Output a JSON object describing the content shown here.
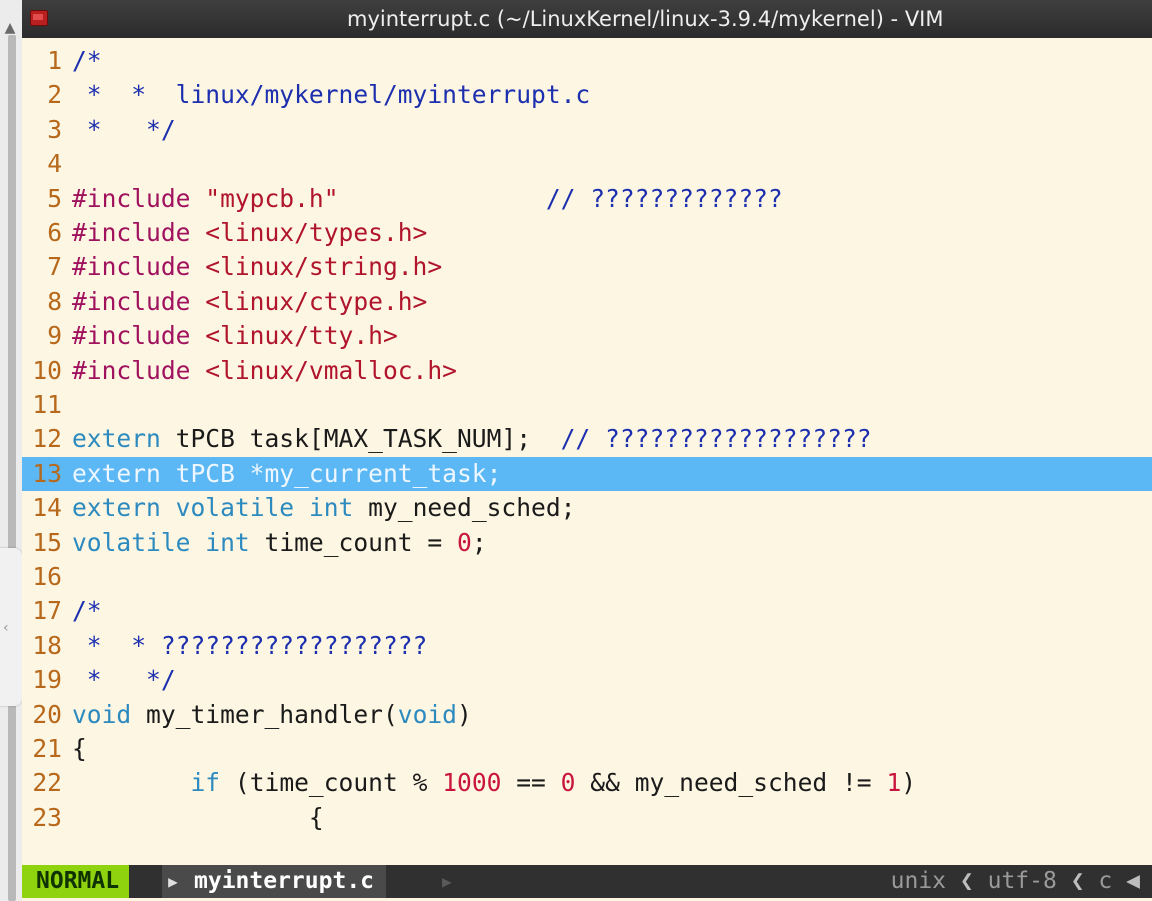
{
  "window": {
    "title": "myinterrupt.c (~/LinuxKernel/linux-3.9.4/mykernel) - VIM"
  },
  "editor": {
    "cursor_line": 13,
    "lines": [
      {
        "n": "1",
        "tokens": [
          {
            "t": "/*",
            "c": "comment"
          }
        ]
      },
      {
        "n": "2",
        "tokens": [
          {
            "t": " *  *  linux/mykernel/myinterrupt.c",
            "c": "comment"
          }
        ]
      },
      {
        "n": "3",
        "tokens": [
          {
            "t": " *   */",
            "c": "comment"
          }
        ]
      },
      {
        "n": "4",
        "tokens": []
      },
      {
        "n": "5",
        "tokens": [
          {
            "t": "#include ",
            "c": "pre"
          },
          {
            "t": "\"mypcb.h\"",
            "c": "str"
          },
          {
            "t": "              ",
            "c": "plain"
          },
          {
            "t": "// ?????????????",
            "c": "comment"
          }
        ]
      },
      {
        "n": "6",
        "tokens": [
          {
            "t": "#include ",
            "c": "pre"
          },
          {
            "t": "<linux/types.h>",
            "c": "str"
          }
        ]
      },
      {
        "n": "7",
        "tokens": [
          {
            "t": "#include ",
            "c": "pre"
          },
          {
            "t": "<linux/string.h>",
            "c": "str"
          }
        ]
      },
      {
        "n": "8",
        "tokens": [
          {
            "t": "#include ",
            "c": "pre"
          },
          {
            "t": "<linux/ctype.h>",
            "c": "str"
          }
        ]
      },
      {
        "n": "9",
        "tokens": [
          {
            "t": "#include ",
            "c": "pre"
          },
          {
            "t": "<linux/tty.h>",
            "c": "str"
          }
        ]
      },
      {
        "n": "10",
        "tokens": [
          {
            "t": "#include ",
            "c": "pre"
          },
          {
            "t": "<linux/vmalloc.h>",
            "c": "str"
          }
        ]
      },
      {
        "n": "11",
        "tokens": []
      },
      {
        "n": "12",
        "tokens": [
          {
            "t": "extern",
            "c": "type"
          },
          {
            "t": " tPCB task[MAX_TASK_NUM];  ",
            "c": "plain"
          },
          {
            "t": "// ??????????????????",
            "c": "comment"
          }
        ]
      },
      {
        "n": "13",
        "tokens": [
          {
            "t": "extern tPCB *my_current_task;",
            "c": "plain"
          }
        ]
      },
      {
        "n": "14",
        "tokens": [
          {
            "t": "extern",
            "c": "type"
          },
          {
            "t": " ",
            "c": "plain"
          },
          {
            "t": "volatile",
            "c": "type"
          },
          {
            "t": " ",
            "c": "plain"
          },
          {
            "t": "int",
            "c": "type"
          },
          {
            "t": " my_need_sched;",
            "c": "plain"
          }
        ]
      },
      {
        "n": "15",
        "tokens": [
          {
            "t": "volatile",
            "c": "type"
          },
          {
            "t": " ",
            "c": "plain"
          },
          {
            "t": "int",
            "c": "type"
          },
          {
            "t": " time_count = ",
            "c": "plain"
          },
          {
            "t": "0",
            "c": "num"
          },
          {
            "t": ";",
            "c": "plain"
          }
        ]
      },
      {
        "n": "16",
        "tokens": []
      },
      {
        "n": "17",
        "tokens": [
          {
            "t": "/*",
            "c": "comment"
          }
        ]
      },
      {
        "n": "18",
        "tokens": [
          {
            "t": " *  * ??????????????????",
            "c": "comment"
          }
        ]
      },
      {
        "n": "19",
        "tokens": [
          {
            "t": " *   */",
            "c": "comment"
          }
        ]
      },
      {
        "n": "20",
        "tokens": [
          {
            "t": "void",
            "c": "type"
          },
          {
            "t": " my_timer_handler(",
            "c": "plain"
          },
          {
            "t": "void",
            "c": "type"
          },
          {
            "t": ")",
            "c": "plain"
          }
        ]
      },
      {
        "n": "21",
        "tokens": [
          {
            "t": "{",
            "c": "plain"
          }
        ]
      },
      {
        "n": "22",
        "tokens": [
          {
            "t": "        ",
            "c": "plain"
          },
          {
            "t": "if",
            "c": "type"
          },
          {
            "t": " (time_count % ",
            "c": "plain"
          },
          {
            "t": "1000",
            "c": "num"
          },
          {
            "t": " == ",
            "c": "plain"
          },
          {
            "t": "0",
            "c": "num"
          },
          {
            "t": " && my_need_sched != ",
            "c": "plain"
          },
          {
            "t": "1",
            "c": "num"
          },
          {
            "t": ")",
            "c": "plain"
          }
        ]
      },
      {
        "n": "23",
        "tokens": [
          {
            "t": "                {",
            "c": "plain"
          }
        ]
      }
    ]
  },
  "statusbar": {
    "mode": "NORMAL",
    "mode_separator": "▶",
    "filename": "myinterrupt.c",
    "file_separator": "▶",
    "fileformat": "unix",
    "encoding": "utf-8",
    "filetype": "c",
    "right_separator": "❮",
    "end_marker": "◀"
  },
  "colors": {
    "background": "#fdf6e3",
    "cursorline": "#5bb8f5",
    "comment": "#1c2fae",
    "preproc": "#a0125e",
    "string": "#b0152c",
    "type": "#2c8abf",
    "number": "#c9153c",
    "linenr": "#b7681a",
    "mode_bg": "#8fd20e"
  },
  "icons": {
    "rail_up": "▲",
    "rail_left": "‹"
  }
}
